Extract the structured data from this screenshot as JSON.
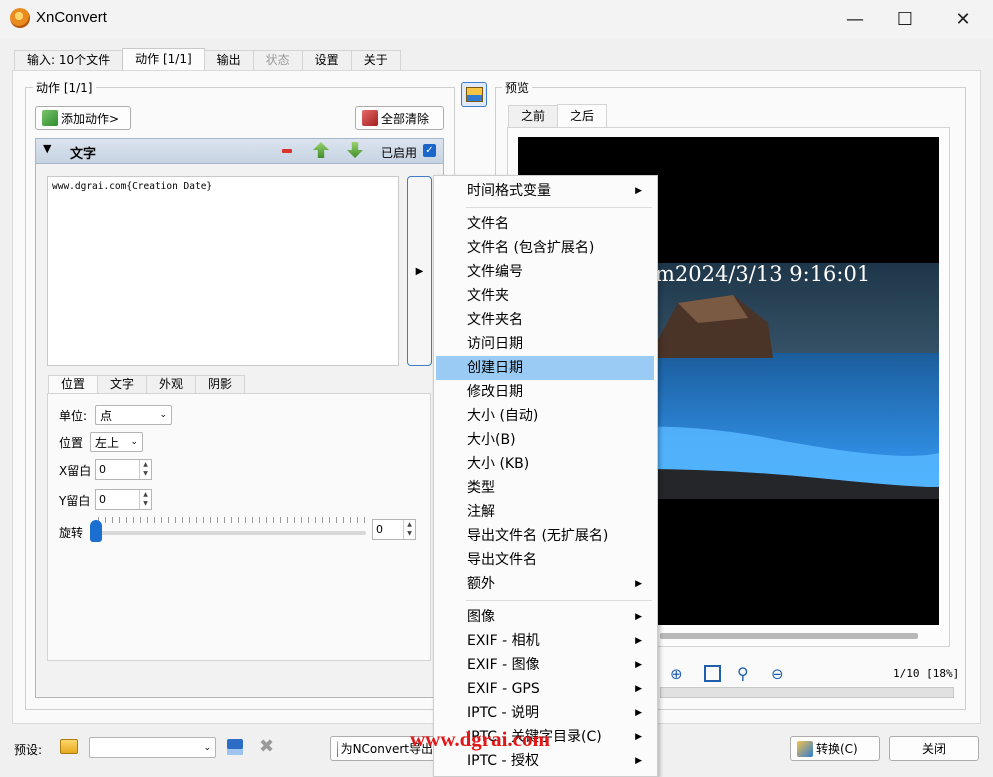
{
  "window": {
    "title": "XnConvert"
  },
  "tabs": [
    {
      "label": "输入: 10个文件",
      "state": "normal"
    },
    {
      "label": "动作 [1/1]",
      "state": "active"
    },
    {
      "label": "输出",
      "state": "normal"
    },
    {
      "label": "状态",
      "state": "disabled"
    },
    {
      "label": "设置",
      "state": "normal"
    },
    {
      "label": "关于",
      "state": "normal"
    }
  ],
  "actions": {
    "legend": "动作 [1/1]",
    "add_button": "添加动作>",
    "clear_button": "全部清除",
    "item_title": "文字",
    "enabled_label": "已启用",
    "enabled": true,
    "text_value": "www.dgrai.com{Creation Date}"
  },
  "subtabs": [
    "位置",
    "文字",
    "外观",
    "阴影"
  ],
  "position": {
    "unit_label": "单位:",
    "unit_value": "点",
    "position_label": "位置",
    "position_value": "左上",
    "x_label": "X留白",
    "x_value": "0",
    "y_label": "Y留白",
    "y_value": "0",
    "rotate_label": "旋转",
    "rotate_value": "0"
  },
  "preview": {
    "legend": "预览",
    "tabs": [
      "之前",
      "之后"
    ],
    "overlay_text": "m2024/3/13 9:16:01",
    "page_info": "1/10 [18%]"
  },
  "menu": {
    "items": [
      {
        "label": "时间格式变量",
        "submenu": true,
        "highlighted": false
      },
      {
        "label": "文件名",
        "submenu": false,
        "highlighted": false
      },
      {
        "label": "文件名 (包含扩展名)",
        "submenu": false,
        "highlighted": false
      },
      {
        "label": "文件编号",
        "submenu": false,
        "highlighted": false
      },
      {
        "label": "文件夹",
        "submenu": false,
        "highlighted": false
      },
      {
        "label": "文件夹名",
        "submenu": false,
        "highlighted": false
      },
      {
        "label": "访问日期",
        "submenu": false,
        "highlighted": false
      },
      {
        "label": "创建日期",
        "submenu": false,
        "highlighted": true
      },
      {
        "label": "修改日期",
        "submenu": false,
        "highlighted": false
      },
      {
        "label": "大小 (自动)",
        "submenu": false,
        "highlighted": false
      },
      {
        "label": "大小(B)",
        "submenu": false,
        "highlighted": false
      },
      {
        "label": "大小 (KB)",
        "submenu": false,
        "highlighted": false
      },
      {
        "label": "类型",
        "submenu": false,
        "highlighted": false
      },
      {
        "label": "注解",
        "submenu": false,
        "highlighted": false
      },
      {
        "label": "导出文件名 (无扩展名)",
        "submenu": false,
        "highlighted": false
      },
      {
        "label": "导出文件名",
        "submenu": false,
        "highlighted": false
      },
      {
        "label": "额外",
        "submenu": true,
        "highlighted": false
      },
      {
        "label": "图像",
        "submenu": true,
        "highlighted": false
      },
      {
        "label": "EXIF - 相机",
        "submenu": true,
        "highlighted": false
      },
      {
        "label": "EXIF - 图像",
        "submenu": true,
        "highlighted": false
      },
      {
        "label": "EXIF - GPS",
        "submenu": true,
        "highlighted": false
      },
      {
        "label": "IPTC - 说明",
        "submenu": true,
        "highlighted": false
      },
      {
        "label": "IPTC - 关键字目录(C)",
        "submenu": true,
        "highlighted": false
      },
      {
        "label": "IPTC - 授权",
        "submenu": true,
        "highlighted": false
      }
    ]
  },
  "bottom": {
    "preset_label": "预设:",
    "export_button": "为NConvert导出",
    "convert_button": "转换(C)",
    "close_button": "关闭"
  },
  "watermark": "www.dgrai.com",
  "icons": {
    "app": "xnconvert-logo-icon",
    "add": "add-action-icon",
    "clear": "clear-all-icon",
    "remove": "minus-icon",
    "up": "move-up-icon",
    "down": "move-down-icon",
    "preview_toggle": "preview-image-icon",
    "zoom_in": "zoom-in-icon",
    "fit": "fit-screen-icon",
    "zoom": "magnifier-icon",
    "zoom_out": "zoom-out-icon",
    "folder": "folder-icon",
    "save": "save-icon",
    "delete": "delete-icon",
    "convert": "convert-icon"
  }
}
